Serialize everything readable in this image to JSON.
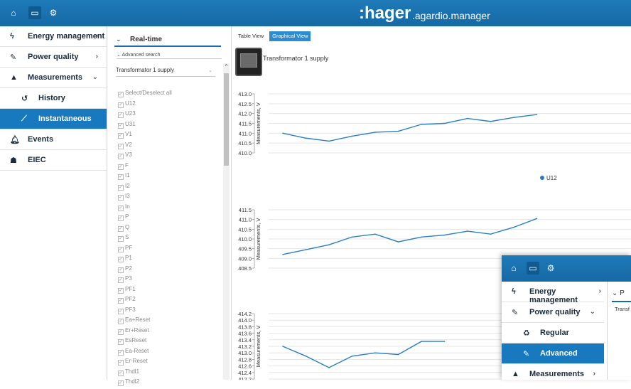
{
  "topbar": {
    "home_icon": "home-icon",
    "monitor_icon": "monitor-icon",
    "settings_icon": "gears-icon",
    "brand": ":hager",
    "brand_sub": ".agardio.manager"
  },
  "sidebar": {
    "items": [
      {
        "label": "Energy management",
        "icon": "bolt-icon",
        "chevron": "›"
      },
      {
        "label": "Power quality",
        "icon": "wrench-icon",
        "chevron": "›"
      },
      {
        "label": "Measurements",
        "icon": "area-chart-icon",
        "chevron": "⌄"
      },
      {
        "label": "History",
        "icon": "history-icon"
      },
      {
        "label": "Instantaneous",
        "icon": "line-chart-icon"
      },
      {
        "label": "Events",
        "icon": "bell-icon"
      },
      {
        "label": "EIEC",
        "icon": "sitemap-icon"
      }
    ]
  },
  "filter": {
    "section_title": "Real-time",
    "advanced_search": "Advanced search",
    "device_select": "Transformator 1 supply",
    "select_all": "Select/Deselect all",
    "variables": [
      "U12",
      "U23",
      "U31",
      "V1",
      "V2",
      "V3",
      "F",
      "I1",
      "I2",
      "I3",
      "In",
      "P",
      "Q",
      "S",
      "PF",
      "P1",
      "P2",
      "P3",
      "PF1",
      "PF2",
      "PF3",
      "Ea+Reset",
      "Er+Reset",
      "EsReset",
      "Ea-Reset",
      "Er-Reset",
      "Thdl1",
      "Thdl2"
    ]
  },
  "main": {
    "tabs": [
      "Table View",
      "Graphical View"
    ],
    "active_tab": 1,
    "device_title": "Transformator 1 supply"
  },
  "chart_data": [
    {
      "type": "line",
      "ylabel": "Measurements, V",
      "yticks": [
        "413.0",
        "412.5",
        "412.0",
        "411.5",
        "411.0",
        "410.5",
        "410.0"
      ],
      "ylim": [
        410.0,
        413.0
      ],
      "series": [
        {
          "name": "U12",
          "values": [
            411.0,
            410.75,
            410.6,
            410.85,
            411.05,
            411.1,
            411.45,
            411.5,
            411.75,
            411.6,
            411.8,
            411.95
          ]
        }
      ],
      "legend": "bottom-center",
      "grid": true
    },
    {
      "type": "line",
      "ylabel": "Measurements, V",
      "yticks": [
        "411.5",
        "411.0",
        "410.5",
        "410.0",
        "409.5",
        "409.0",
        "408.5"
      ],
      "ylim": [
        408.5,
        411.5
      ],
      "series": [
        {
          "values": [
            409.2,
            409.45,
            409.7,
            410.1,
            410.25,
            409.85,
            410.1,
            410.2,
            410.4,
            410.25,
            410.6,
            411.05
          ]
        }
      ],
      "grid": true
    },
    {
      "type": "line",
      "ylabel": "Measurements, V",
      "yticks": [
        "414.2",
        "414.0",
        "413.8",
        "413.6",
        "413.4",
        "413.2",
        "413.0",
        "412.8",
        "412.6",
        "412.4",
        "412.2"
      ],
      "ylim": [
        412.2,
        414.2
      ],
      "series": [
        {
          "values": [
            413.2,
            412.9,
            412.55,
            412.9,
            413.0,
            412.95,
            413.35,
            413.35
          ]
        }
      ],
      "grid": true
    }
  ],
  "overlay": {
    "items": [
      {
        "label": "Energy management",
        "icon": "bolt-icon",
        "chevron": "›"
      },
      {
        "label": "Power quality",
        "icon": "wrench-icon",
        "chevron": "⌄"
      },
      {
        "label": "Regular",
        "icon": "recycle-icon"
      },
      {
        "label": "Advanced",
        "icon": "wrench-icon"
      },
      {
        "label": "Measurements",
        "icon": "area-chart-icon",
        "chevron": "›"
      }
    ],
    "panel_head": "P",
    "panel_text": "Transf"
  },
  "colors": {
    "accent": "#1979be",
    "topbar": "#1a72b0",
    "series": "#2a7fc4"
  }
}
